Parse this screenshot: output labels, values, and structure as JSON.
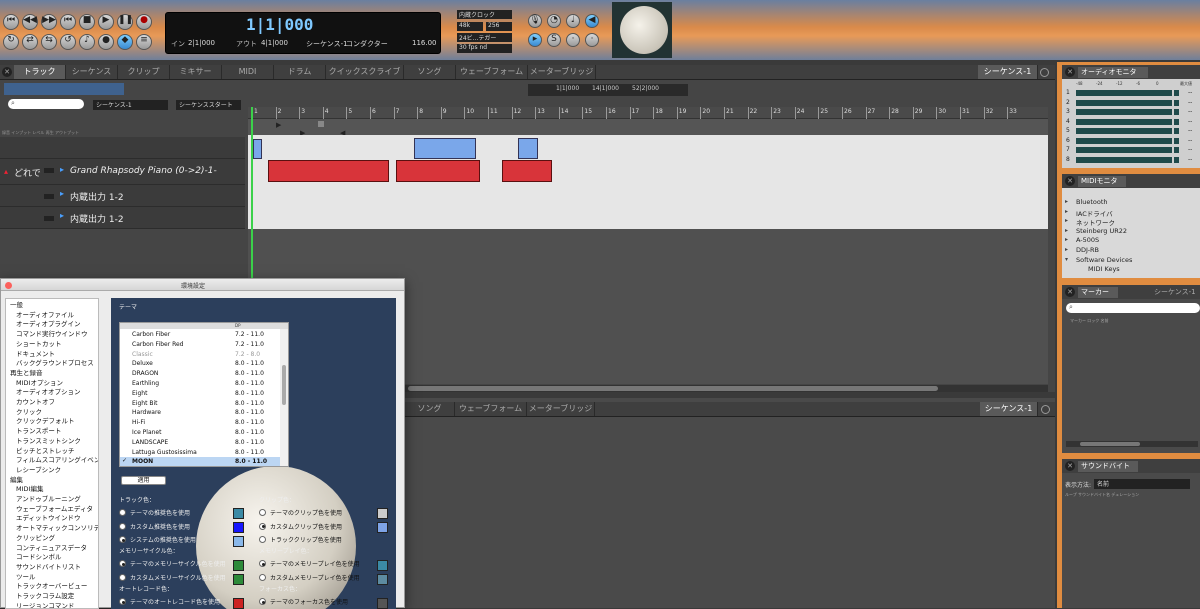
{
  "transport": {
    "position": "1|1|000",
    "in_label": "イン",
    "in_value": "2|1|000",
    "out_label": "アウト",
    "out_value": "4|1|000",
    "sequence": "シーケンス-1",
    "conductor": "コンダクター",
    "tempo": "116.00",
    "clock": "内蔵クロック",
    "sample_rate": "48k",
    "buffer": "256",
    "beat_display": "24ビ...テガー",
    "fps": "30 fps nd"
  },
  "main_tabs": [
    "トラック",
    "シーケンス",
    "クリップ",
    "ミキサー",
    "MIDI",
    "ドラム",
    "クイックスクライブ",
    "ソング",
    "ウェーブフォーム",
    "メーターブリッジ"
  ],
  "sequence_tab": "シーケンス-1",
  "track_header": {
    "search_placeholder": "",
    "sequence_select": "シーケンス-1",
    "start_select": "シーケンススタート",
    "col_headers": "録音 インプット レベル 再生 アウトプット"
  },
  "tracks": [
    {
      "name": "Grand Rhapsody Piano (0->2)-1-",
      "input": "どれで"
    },
    {
      "name": "内蔵出力 1-2"
    },
    {
      "name": "内蔵出力 1-2"
    }
  ],
  "toolbar_counters": {
    "a": "1|1|000",
    "b": "14|1|000",
    "c": "52|2|000"
  },
  "ruler": [
    "1",
    "2",
    "3",
    "4",
    "5",
    "6",
    "7",
    "8",
    "9",
    "10",
    "11",
    "12",
    "13",
    "14",
    "15",
    "16",
    "17",
    "18",
    "19",
    "20",
    "21",
    "22",
    "23",
    "24",
    "25",
    "26",
    "27",
    "28",
    "29",
    "30",
    "31",
    "32",
    "33"
  ],
  "audio_monitor": {
    "title": "オーディオモニタ",
    "scale": [
      "-48",
      "-24",
      "-12",
      "-6",
      "0"
    ],
    "channels": [
      "1",
      "2",
      "3",
      "4",
      "5",
      "6",
      "7",
      "8"
    ],
    "right_header": "最大値",
    "values": [
      "--",
      "--",
      "--",
      "--",
      "--",
      "--",
      "--",
      "--"
    ]
  },
  "midi_monitor": {
    "title": "MIDIモニタ",
    "items": [
      "Bluetooth",
      "IACドライバ",
      "ネットワーク",
      "Steinberg UR22",
      "A-500S",
      "DDJ-RB",
      "Software Devices",
      "MIDI Keys"
    ]
  },
  "marker": {
    "title": "マーカー",
    "tab": "シーケンス-1",
    "cols": "マーカー ロック 名前"
  },
  "soundbite": {
    "title": "サウンドバイト",
    "display_label": "表示方法:",
    "display_value": "名前",
    "cols": "ループ サウンドバイト名 デュレーション"
  },
  "lower_tabs": [
    "ソング",
    "ウェーブフォーム",
    "メーターブリッジ"
  ],
  "lower_sequence_tab": "シーケンス-1",
  "prefs": {
    "title": "環境設定",
    "sidebar": [
      "一般",
      "オーディオファイル",
      "オーディオプラグイン",
      "コマンド実行ウインドウ",
      "ショートカット",
      "ドキュメント",
      "バックグラウンドプロセス",
      "再生と録音",
      "MIDIオプション",
      "オーディオオプション",
      "カウントオフ",
      "クリック",
      "クリックデフォルト",
      "トランスポート",
      "トランスミットシンク",
      "ピッチとストレッチ",
      "フィルムスコアリングイベント",
      "レシーブシンク",
      "編集",
      "MIDI編集",
      "アンドゥブルーニング",
      "ウェーブフォームエディタ",
      "エディットウインドウ",
      "オートマティックコンソリデート",
      "クリッピング",
      "コンティニュアスデータ",
      "コードシンボル",
      "サウンドバイトリスト",
      "ツール",
      "トラックオーバービュー",
      "トラックコラム設定",
      "リージョンコマンド"
    ],
    "theme_header": "テーマ",
    "theme_col_dp": "DP",
    "themes": [
      {
        "name": "Carbon Fiber",
        "ver": "7.2 - 11.0"
      },
      {
        "name": "Carbon Fiber Red",
        "ver": "7.2 - 11.0"
      },
      {
        "name": "Classic",
        "ver": "7.2 - 8.0"
      },
      {
        "name": "Deluxe",
        "ver": "8.0 - 11.0"
      },
      {
        "name": "DRAGON",
        "ver": "8.0 - 11.0"
      },
      {
        "name": "Earthling",
        "ver": "8.0 - 11.0"
      },
      {
        "name": "Eight",
        "ver": "8.0 - 11.0"
      },
      {
        "name": "Eight Bit",
        "ver": "8.0 - 11.0"
      },
      {
        "name": "Hardware",
        "ver": "8.0 - 11.0"
      },
      {
        "name": "Hi-Fi",
        "ver": "8.0 - 11.0"
      },
      {
        "name": "Ice Planet",
        "ver": "8.0 - 11.0"
      },
      {
        "name": "LANDSCAPE",
        "ver": "8.0 - 11.0"
      },
      {
        "name": "Lattuga Gustosissima",
        "ver": "8.0 - 11.0"
      },
      {
        "name": "MOON",
        "ver": "8.0 - 11.0"
      },
      {
        "name": "MOTools",
        "ver": "7.2 - 11.0"
      }
    ],
    "selected_check": "✓",
    "apply": "適用",
    "track_color_header": "トラック色：",
    "track_color_opts": [
      "テーマの推奨色を使用",
      "カスタム推奨色を使用",
      "システムの推奨色を使用"
    ],
    "clip_color_header": "クリップ色：",
    "clip_color_opts": [
      "テーマのクリップ色を使用",
      "カスタムクリップ色を使用",
      "トラッククリップ色を使用"
    ],
    "meter_header": "メモリーサイクル色：",
    "meter_opts": [
      "テーマのメモリーサイクル色を使用",
      "カスタムメモリーサイクル色を使用"
    ],
    "memplay_header": "メモリープレイ色：",
    "memplay_opts": [
      "テーマのメモリープレイ色を使用",
      "カスタムメモリープレイ色を使用"
    ],
    "autorec_header": "オートレコード色：",
    "autorec_opts": [
      "テーマのオートレコード色を使用"
    ],
    "focus_header": "フォーカス色：",
    "focus_opts": [
      "テーマのフォーカス色を使用"
    ]
  },
  "colors": {
    "accent_orange": "#f0a040",
    "clip_blue": "#7aa7ea",
    "clip_red": "#d8343a",
    "swatch_teal": "#3b8aa5",
    "swatch_blue": "#1616ff",
    "swatch_lightblue": "#8ab8ea",
    "swatch_green": "#2d8a3a",
    "swatch_red": "#cc2222"
  }
}
